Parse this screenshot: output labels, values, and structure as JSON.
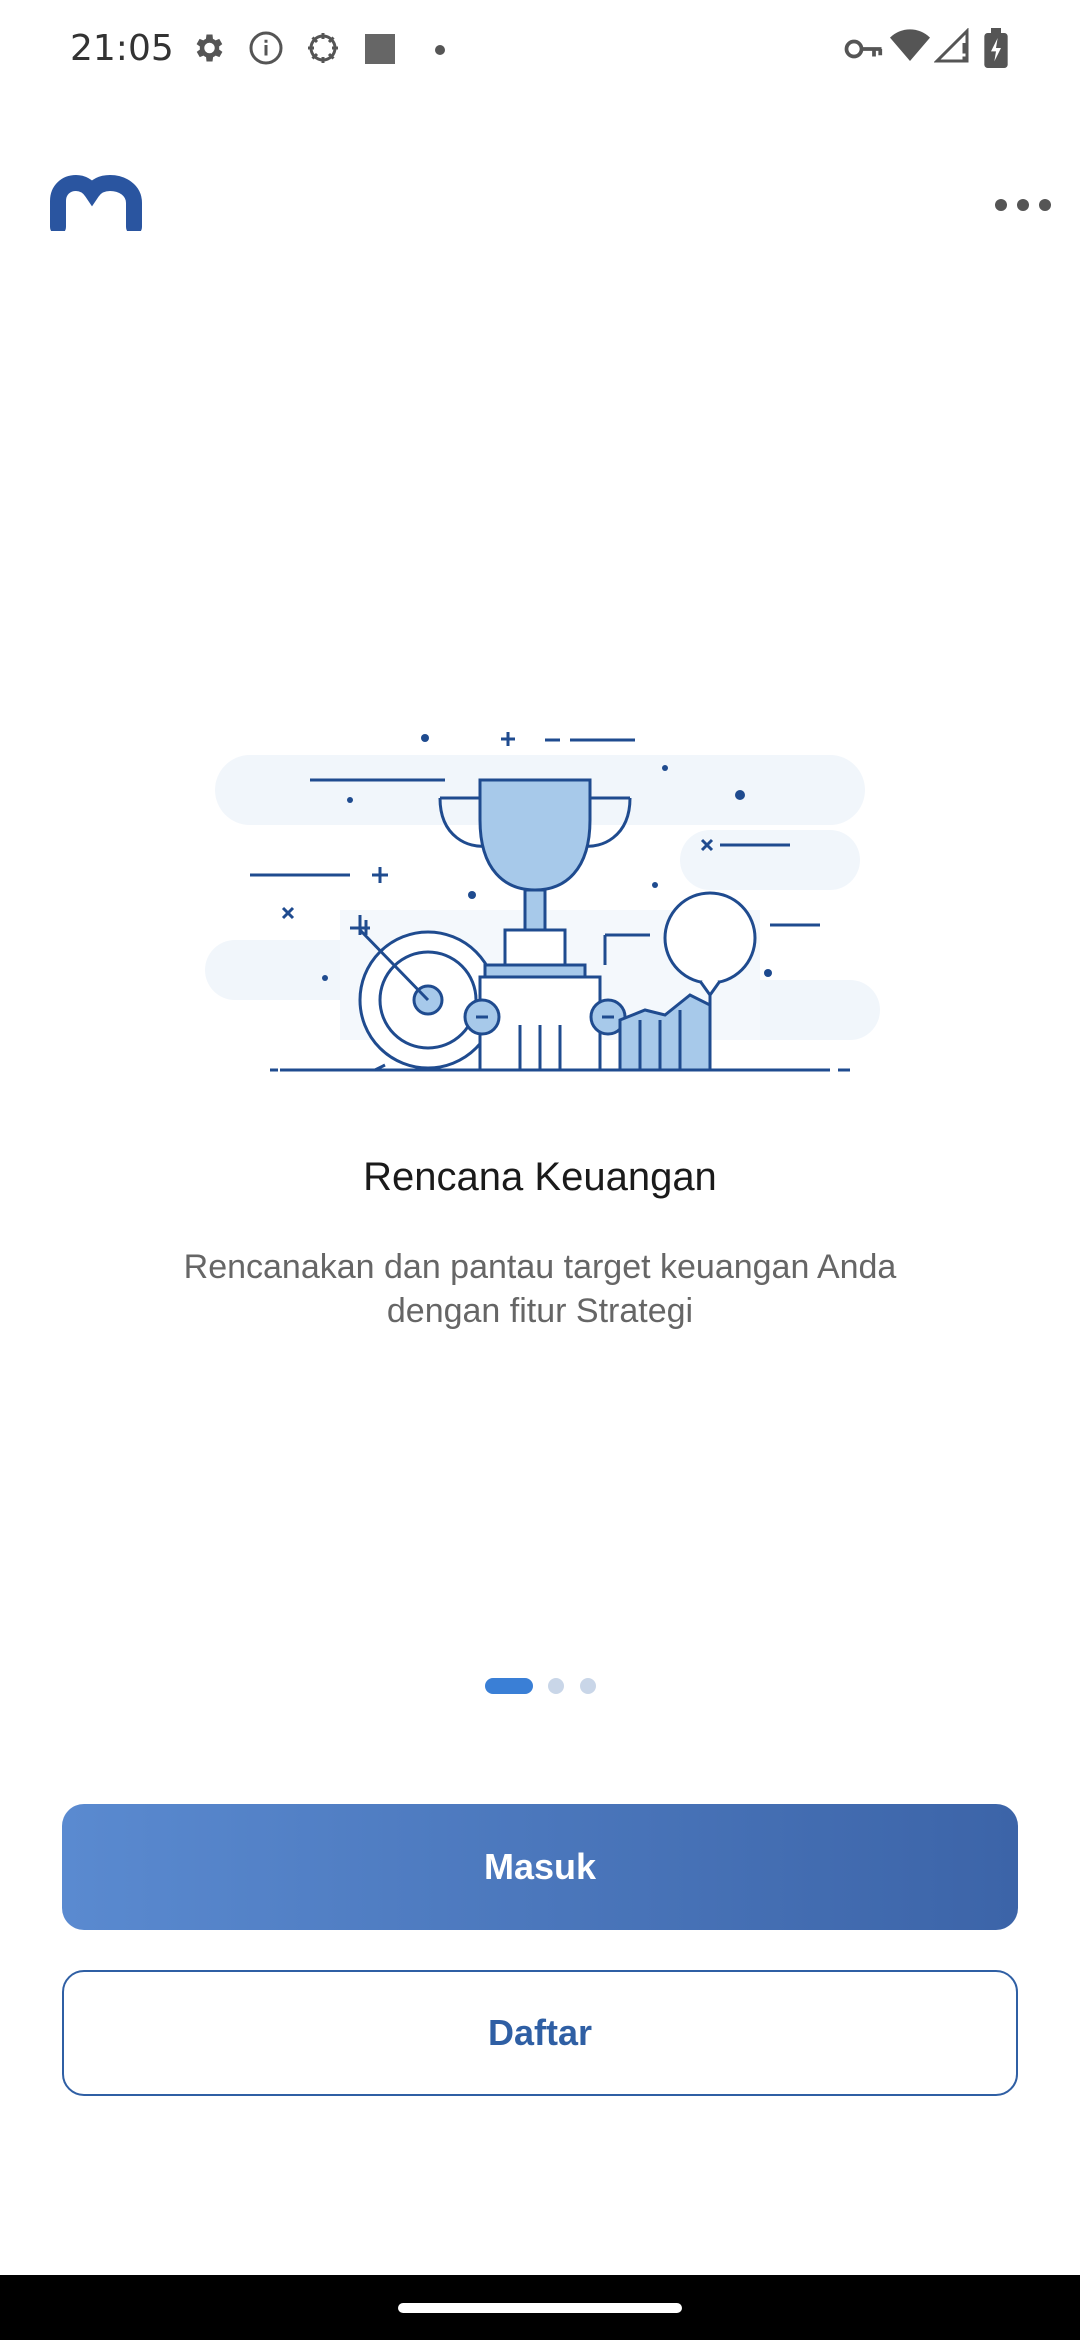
{
  "status_bar": {
    "time": "21:05",
    "left_icons": [
      "gear-icon",
      "info-icon",
      "bug-icon",
      "square-icon",
      "dot-icon"
    ],
    "right_icons": [
      "vpn-key-icon",
      "wifi-icon",
      "signal-icon",
      "battery-charging-icon"
    ]
  },
  "header": {
    "logo_icon": "m-logo-icon",
    "menu_icon": "more-horizontal-icon"
  },
  "onboarding": {
    "illustration_icon": "trophy-target-illustration",
    "title": "Rencana Keuangan",
    "description": "Rencanakan dan pantau target keuangan Anda dengan fitur Strategi",
    "pager": {
      "total": 3,
      "current": 1
    }
  },
  "buttons": {
    "login": "Masuk",
    "register": "Daftar"
  },
  "colors": {
    "brand": "#2f5fa4",
    "accent": "#3a7fd6",
    "button_gradient_start": "#5a8ad0",
    "button_gradient_end": "#3c64a8"
  }
}
